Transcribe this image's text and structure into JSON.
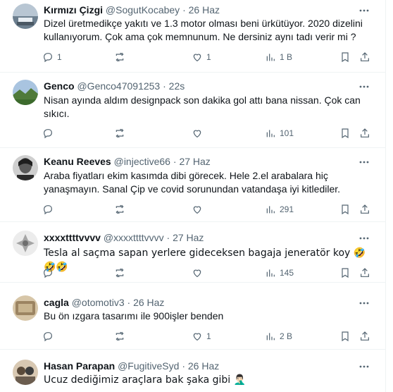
{
  "tweets": [
    {
      "name": "Kırmızı Çizgi",
      "handle": "@SogutKocabey",
      "dot": "·",
      "time": "26 Haz",
      "text": "Dizel üretmedikçe yakıtı ve 1.3 motor olması beni ürkütüyor. 2020 dizelini kullanıyorum. Çok ama çok memnunum. Ne dersiniz aynı tadı verir mi ?",
      "replies": "1",
      "retweets": "",
      "likes": "1",
      "views": "1 B",
      "avatar_colors": [
        "#8fa4b8",
        "#5c6e7e"
      ]
    },
    {
      "name": "Genco",
      "handle": "@Genco47091253",
      "dot": "·",
      "time": "22s",
      "text": "Nisan ayında aldım designpack son dakika gol attı bana nissan. Çok can sıkıcı.",
      "replies": "",
      "retweets": "",
      "likes": "",
      "views": "101",
      "avatar_colors": [
        "#9db7d6",
        "#4f7a3a"
      ]
    },
    {
      "name": "Keanu Reeves",
      "handle": "@injective66",
      "dot": "·",
      "time": "27 Haz",
      "text": "Araba fiyatları ekim kasımda dibi görecek. Hele 2.el arabalara hiç yanaşmayın. Sanal Çip ve covid sorunundan vatandaşa iyi kitlediler.",
      "replies": "",
      "retweets": "",
      "likes": "",
      "views": "291",
      "avatar_colors": [
        "#d9d9d9",
        "#2b2b2b"
      ]
    },
    {
      "name": "xxxxttttvvvv",
      "handle": "@xxxxttttvvvv",
      "dot": "·",
      "time": "27 Haz",
      "text": "Tesla al saçma sapan yerlere gideceksen bagaja jeneratör koy 🤣🤣🤣",
      "replies": "",
      "retweets": "",
      "likes": "",
      "views": "145",
      "avatar_colors": [
        "#e8e8e8",
        "#9a9a9a"
      ]
    },
    {
      "name": "cagla",
      "handle": "@otomotiv3",
      "dot": "·",
      "time": "26 Haz",
      "text": "Bu ön ızgara tasarımı ile 900işler benden",
      "replies": "",
      "retweets": "",
      "likes": "1",
      "views": "2 B",
      "avatar_colors": [
        "#cbb89a",
        "#8a7456"
      ]
    },
    {
      "name": "Hasan Parapan",
      "handle": "@FugitiveSyd",
      "dot": "·",
      "time": "26 Haz",
      "text": "Ucuz dediğimiz araçlara bak şaka gibi 🤦🏻‍♂️",
      "replies": "",
      "retweets": "",
      "likes": "",
      "views": "",
      "avatar_colors": [
        "#c9b6a0",
        "#3d3d3d"
      ]
    }
  ],
  "icons": {
    "more": "more-icon",
    "reply": "reply-icon",
    "retweet": "retweet-icon",
    "like": "like-icon",
    "views": "views-icon",
    "bookmark": "bookmark-icon",
    "share": "share-icon"
  },
  "colors": {
    "text": "#0f1419",
    "secondary": "#536471",
    "divider": "#eff3f4"
  }
}
